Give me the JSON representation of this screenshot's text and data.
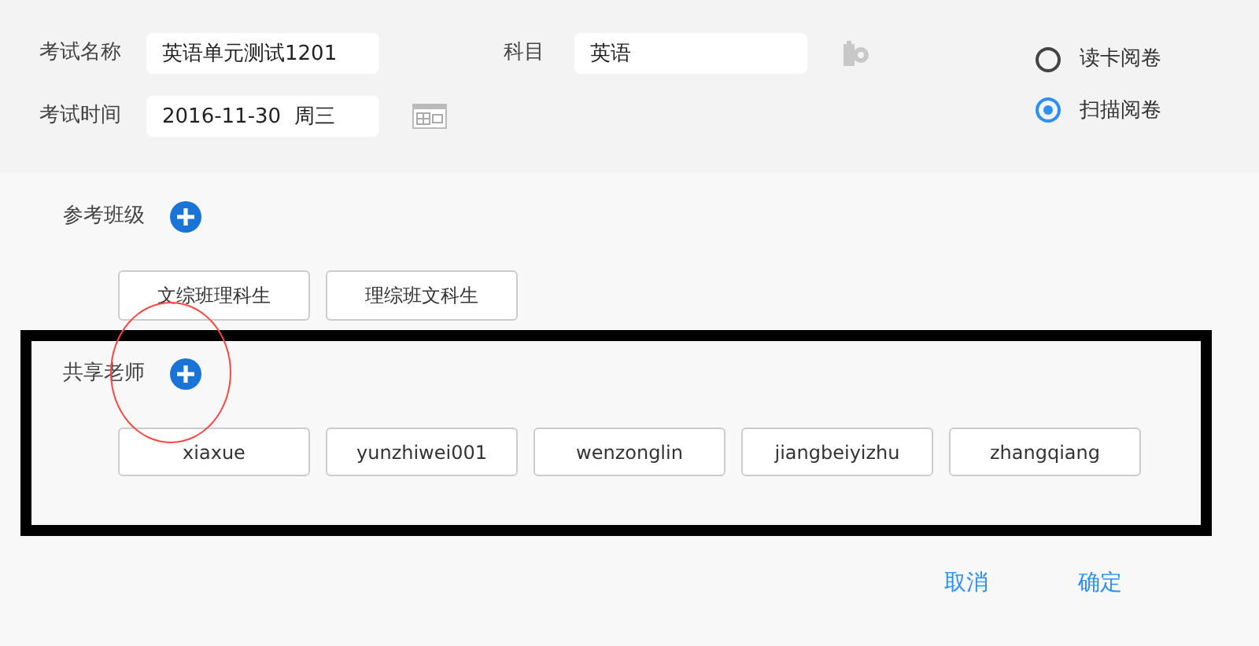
{
  "exam_form": {
    "name_label": "考试名称",
    "name_value": "英语单元测试1201",
    "subject_label": "科目",
    "subject_value": "英语",
    "time_label": "考试时间",
    "time_value": "2016-11-30  周三"
  },
  "review_modes": [
    {
      "label": "读卡阅卷",
      "selected": false
    },
    {
      "label": "扫描阅卷",
      "selected": true
    }
  ],
  "classes": {
    "label": "参考班级",
    "items": [
      "文综班理科生",
      "理综班文科生"
    ]
  },
  "teachers": {
    "label": "共享老师",
    "items": [
      "xiaxue",
      "yunzhiwei001",
      "wenzonglin",
      "jiangbeiyizhu",
      "zhangqiang"
    ]
  },
  "actions": [
    "取消",
    "确定"
  ],
  "annotations": [
    {
      "kind": "rectangle",
      "color": "#000000"
    },
    {
      "kind": "ellipse",
      "color": "#ff4444"
    }
  ]
}
